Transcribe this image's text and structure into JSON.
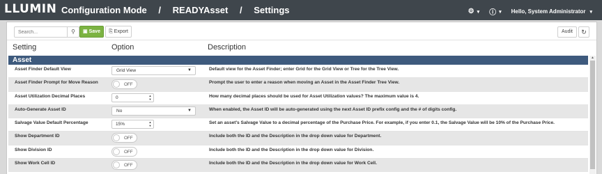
{
  "app": {
    "logo_text": "LLUMIN",
    "breadcrumb": [
      "Configuration Mode",
      "READYAsset",
      "Settings"
    ],
    "user_greeting": "Hello, System Administrator"
  },
  "toolbar": {
    "search_placeholder": "Search...",
    "save_label": "Save",
    "export_label": "Export",
    "audit_label": "Audit"
  },
  "columns": {
    "setting": "Setting",
    "option": "Option",
    "description": "Description"
  },
  "section": {
    "title": "Asset"
  },
  "rows": [
    {
      "setting": "Asset Finder Default View",
      "option_type": "select",
      "option_value": "Grid View",
      "description": "Default view for the Asset Finder; enter Grid for the Grid View or Tree for the Tree View."
    },
    {
      "setting": "Asset Finder Prompt for Move Reason",
      "option_type": "toggle",
      "option_value": "OFF",
      "description": "Prompt the user to enter a reason when moving an Asset in the Asset Finder Tree View."
    },
    {
      "setting": "Asset Utilization Decimal Places",
      "option_type": "number",
      "option_value": "0",
      "description": "How many decimal places should be used for Asset Utilization values? The maximum value is 4."
    },
    {
      "setting": "Auto-Generate Asset ID",
      "option_type": "select",
      "option_value": "No",
      "description": "When enabled, the Asset ID will be auto-generated using the next Asset ID prefix config and the # of digits config."
    },
    {
      "setting": "Salvage Value Default Percentage",
      "option_type": "number",
      "option_value": "15%",
      "description": "Set an asset's Salvage Value to a decimal percentage of the Purchase Price. For example, if you enter 0.1, the Salvage Value will be 10% of the Purchase Price."
    },
    {
      "setting": "Show Department ID",
      "option_type": "toggle",
      "option_value": "OFF",
      "description": "Include both the ID and the Description in the drop down value for Department."
    },
    {
      "setting": "Show Division ID",
      "option_type": "toggle",
      "option_value": "OFF",
      "description": "Include both the ID and the Description in the drop down value for Division."
    },
    {
      "setting": "Show Work Cell ID",
      "option_type": "toggle",
      "option_value": "OFF",
      "description": "Include both the ID and the Description in the drop down value for Work Cell."
    }
  ],
  "icons": {
    "settings": "gear-icon",
    "info": "info-icon",
    "search": "search-icon",
    "save": "save-icon",
    "export": "export-icon",
    "refresh": "refresh-icon"
  },
  "colors": {
    "topbar": "#3f464c",
    "section_header": "#3e5a7d",
    "save_button": "#7cb342"
  }
}
